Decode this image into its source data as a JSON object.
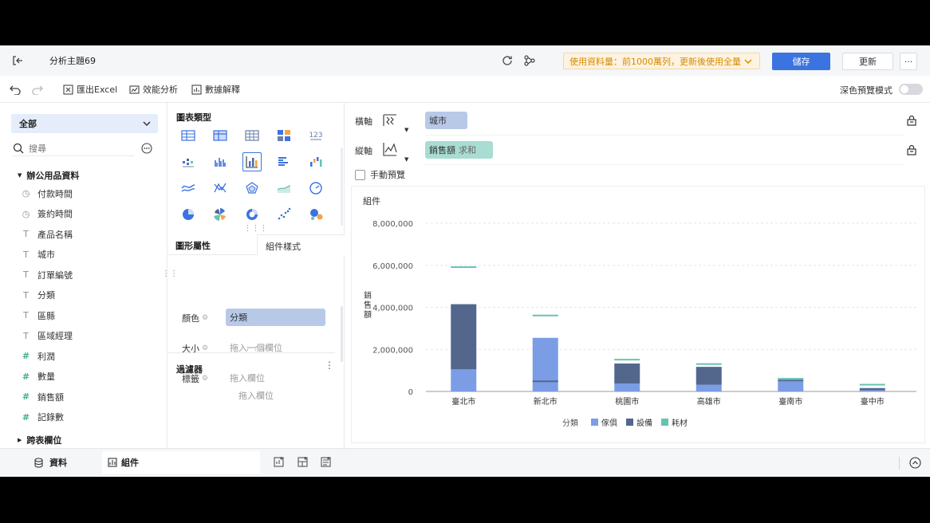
{
  "header": {
    "title": "分析主題69",
    "usage_notice": "使用資料量：前1000萬列，更新後使用全量",
    "save_label": "儲存",
    "update_label": "更新",
    "more_label": "···"
  },
  "toolbar": {
    "export_excel": "匯出Excel",
    "performance": "效能分析",
    "data_explain": "數據解釋",
    "dark_preview": "深色預覽模式",
    "dark_preview_on": false
  },
  "data_panel": {
    "scope": "全部",
    "search_placeholder": "搜尋",
    "group_name": "辦公用品資料",
    "fields": [
      {
        "icon": "clock",
        "name": "付款時間"
      },
      {
        "icon": "clock",
        "name": "簽約時間"
      },
      {
        "icon": "text",
        "name": "產品名稱"
      },
      {
        "icon": "text",
        "name": "城市"
      },
      {
        "icon": "text",
        "name": "訂單編號"
      },
      {
        "icon": "text",
        "name": "分類"
      },
      {
        "icon": "text",
        "name": "區縣"
      },
      {
        "icon": "text",
        "name": "區域經理"
      },
      {
        "icon": "number",
        "name": "利潤"
      },
      {
        "icon": "number",
        "name": "數量"
      },
      {
        "icon": "number",
        "name": "銷售額"
      },
      {
        "icon": "number",
        "name": "記錄數"
      }
    ],
    "cross_table": "跨表欄位"
  },
  "config_panel": {
    "chart_type_title": "圖表類型",
    "tab_properties": "圖形屬性",
    "tab_style": "組件樣式",
    "color_label": "顏色",
    "color_value": "分類",
    "size_label": "大小",
    "size_placeholder": "拖入一個欄位",
    "label_label": "標籤",
    "label_placeholder": "拖入欄位",
    "filter_title": "過濾器",
    "filter_placeholder": "拖入欄位"
  },
  "axes": {
    "x_label": "橫軸",
    "x_field": "城市",
    "y_label": "縱軸",
    "y_field": "銷售額",
    "y_agg": "求和",
    "manual_preview": "手動預覽"
  },
  "chart_data": {
    "type": "bar",
    "title": "組件",
    "ylabel": "銷售額",
    "categories": [
      "臺北市",
      "新北市",
      "桃園市",
      "高雄市",
      "臺南市",
      "臺中市"
    ],
    "ylim": [
      0,
      8000000
    ],
    "yticks": [
      "0",
      "2,000,000",
      "4,000,000",
      "6,000,000",
      "8,000,000"
    ],
    "ytick_values": [
      0,
      2000000,
      4000000,
      6000000,
      8000000
    ],
    "legend_title": "分類",
    "series": [
      {
        "name": "傢俱",
        "color": "#7b9de6",
        "values": [
          1050000,
          2550000,
          380000,
          320000,
          480000,
          60000
        ]
      },
      {
        "name": "設備",
        "color": "#53678d",
        "values": [
          4150000,
          520000,
          1330000,
          1170000,
          560000,
          160000
        ]
      },
      {
        "name": "耗材",
        "color": "#67c2b3",
        "values": [
          5950000,
          3650000,
          1550000,
          1340000,
          640000,
          360000
        ]
      }
    ],
    "grid": true,
    "legend_position": "bottom"
  }
}
